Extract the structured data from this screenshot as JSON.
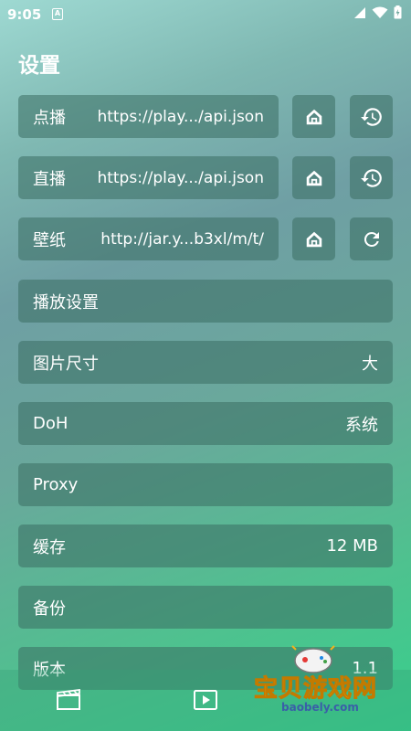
{
  "status": {
    "time": "9:05",
    "notif_icon": "A"
  },
  "page": {
    "title": "设置"
  },
  "sources": [
    {
      "label": "点播",
      "url": "https://play.../api.json",
      "action_icon": "history-icon"
    },
    {
      "label": "直播",
      "url": "https://play.../api.json",
      "action_icon": "history-icon"
    },
    {
      "label": "壁纸",
      "url": "http://jar.y...b3xl/m/t/",
      "action_icon": "refresh-icon"
    }
  ],
  "settings": [
    {
      "label": "播放设置",
      "value": ""
    },
    {
      "label": "图片尺寸",
      "value": "大"
    },
    {
      "label": "DoH",
      "value": "系统"
    },
    {
      "label": "Proxy",
      "value": ""
    },
    {
      "label": "缓存",
      "value": "12 MB"
    },
    {
      "label": "备份",
      "value": ""
    },
    {
      "label": "版本",
      "value": "1.1"
    }
  ],
  "watermark": {
    "text": "宝贝游戏网",
    "sub": "baobely.com"
  },
  "colors": {
    "row_bg": "#3a6e62",
    "accent": "#37cf8c",
    "text": "#ffffff"
  }
}
